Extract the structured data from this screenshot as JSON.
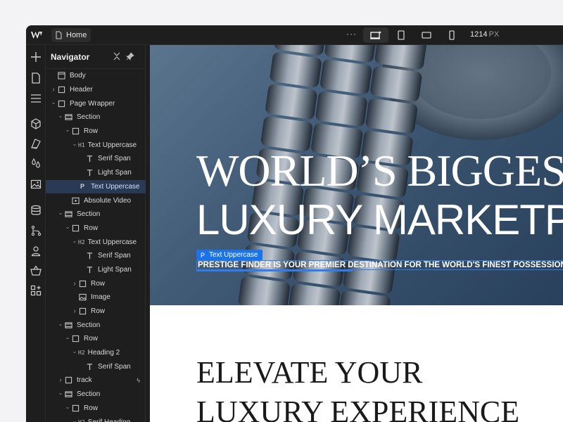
{
  "topbar": {
    "page_name": "Home",
    "more": "···",
    "width_value": "1214",
    "width_unit": "PX"
  },
  "navigator": {
    "title": "Navigator",
    "items": [
      {
        "label": "Body",
        "tag": "",
        "icon": "body-icon",
        "caret": ""
      },
      {
        "label": "Header",
        "tag": "",
        "icon": "box-icon",
        "caret": "right"
      },
      {
        "label": "Page Wrapper",
        "tag": "",
        "icon": "box-icon",
        "caret": "down"
      },
      {
        "label": "Section",
        "tag": "",
        "icon": "section-icon",
        "caret": "down"
      },
      {
        "label": "Row",
        "tag": "",
        "icon": "box-icon",
        "caret": "down"
      },
      {
        "label": "Text Uppercase",
        "tag": "H1",
        "icon": "",
        "caret": "down"
      },
      {
        "label": "Serif Span",
        "tag": "",
        "icon": "text-icon",
        "caret": ""
      },
      {
        "label": "Light Span",
        "tag": "",
        "icon": "text-icon",
        "caret": ""
      },
      {
        "label": "Text Uppercase",
        "tag": "",
        "icon": "paragraph-icon",
        "caret": "",
        "selected": true
      },
      {
        "label": "Absolute Video",
        "tag": "",
        "icon": "video-icon",
        "caret": ""
      },
      {
        "label": "Section",
        "tag": "",
        "icon": "section-icon",
        "caret": "down"
      },
      {
        "label": "Row",
        "tag": "",
        "icon": "box-icon",
        "caret": "down"
      },
      {
        "label": "Text Uppercase",
        "tag": "H2",
        "icon": "",
        "caret": "down"
      },
      {
        "label": "Serif Span",
        "tag": "",
        "icon": "text-icon",
        "caret": ""
      },
      {
        "label": "Light Span",
        "tag": "",
        "icon": "text-icon",
        "caret": ""
      },
      {
        "label": "Row",
        "tag": "",
        "icon": "box-icon",
        "caret": "right"
      },
      {
        "label": "Image",
        "tag": "",
        "icon": "image-icon",
        "caret": ""
      },
      {
        "label": "Row",
        "tag": "",
        "icon": "box-icon",
        "caret": "right"
      },
      {
        "label": "Section",
        "tag": "",
        "icon": "section-icon",
        "caret": "down"
      },
      {
        "label": "Row",
        "tag": "",
        "icon": "box-icon",
        "caret": "down"
      },
      {
        "label": "Heading 2",
        "tag": "H2",
        "icon": "",
        "caret": "down"
      },
      {
        "label": "Serif Span",
        "tag": "",
        "icon": "text-icon",
        "caret": ""
      },
      {
        "label": "track",
        "tag": "",
        "icon": "box-icon",
        "caret": "right",
        "bolt": true
      },
      {
        "label": "Section",
        "tag": "",
        "icon": "section-icon",
        "caret": "down"
      },
      {
        "label": "Row",
        "tag": "",
        "icon": "box-icon",
        "caret": "down"
      },
      {
        "label": "Serif Heading",
        "tag": "H2",
        "icon": "",
        "caret": "down"
      }
    ],
    "indents": [
      0,
      0,
      0,
      1,
      2,
      3,
      4,
      4,
      3,
      2,
      1,
      2,
      3,
      4,
      4,
      3,
      3,
      3,
      1,
      2,
      3,
      4,
      1,
      1,
      2,
      3
    ]
  },
  "canvas": {
    "hero_line1": "WORLD’S BIGGEST",
    "hero_line2": "LUXURY MARKETPL",
    "selection_badge_tag": "P",
    "selection_badge_label": "Text Uppercase",
    "hero_subtitle": "PRESTIGE FINDER IS YOUR PREMIER DESTINATION FOR THE WORLD'S FINEST POSSESSIONS",
    "section2_line1": "ELEVATE YOUR",
    "section2_line2": "LUXURY EXPERIENCE"
  },
  "colors": {
    "accent": "#1a73e8",
    "selected_row": "#2a3a55",
    "panel": "#1e1e1e"
  }
}
